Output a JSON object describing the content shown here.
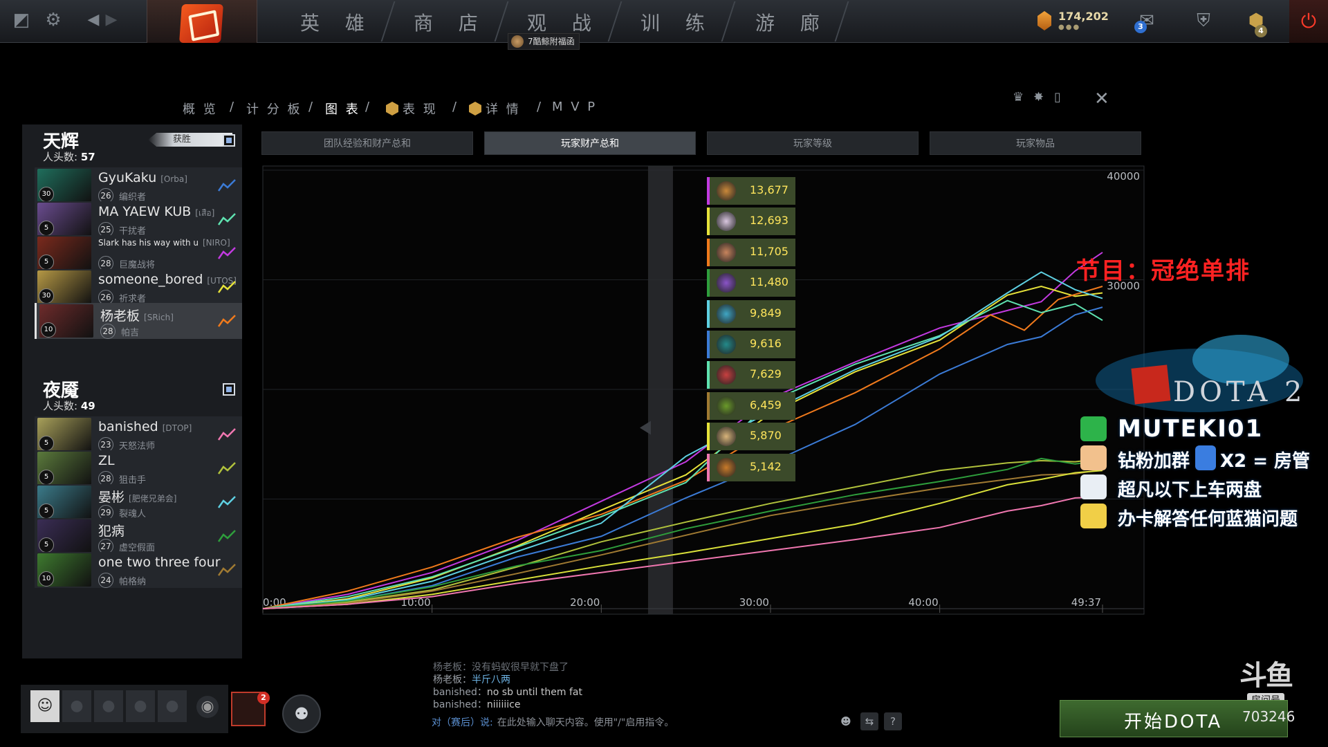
{
  "nav": {
    "items": [
      "英 雄",
      "商 店",
      "观 战",
      "训 练",
      "游 廊"
    ],
    "watch_badge": "7酷鲸附福函",
    "currency": "174,202",
    "currency_dots": "●●●",
    "notif_mail": "3",
    "notif_plus": "4"
  },
  "tabs": {
    "overview": "概 览",
    "scoreboard": "计 分 板",
    "graphs": "图 表",
    "performance": "表 现",
    "details": "详 情",
    "mvp": "M V P",
    "sep": "/"
  },
  "radiant": {
    "name": "天辉",
    "kills_label": "人头数:",
    "kills": "57",
    "win_label": "获胜",
    "players": [
      {
        "name": "GyuKaku",
        "tag": "[Orba]",
        "level": "26",
        "hero": "编织者",
        "badge": "30",
        "color": "#3b7bd6"
      },
      {
        "name": "MA YAEW KUB",
        "tag": "[เสือ]",
        "level": "25",
        "hero": "干扰者",
        "badge": "5",
        "color": "#5fe2b0"
      },
      {
        "name": "Slark has his way with u",
        "tag": "[NIRO]",
        "level": "28",
        "hero": "巨魔战将",
        "badge": "5",
        "color": "#c23ae0"
      },
      {
        "name": "someone_bored",
        "tag": "[UTOS]",
        "level": "26",
        "hero": "祈求者",
        "badge": "30",
        "color": "#e6e23a"
      },
      {
        "name": "杨老板",
        "tag": "[SRich]",
        "level": "28",
        "hero": "帕吉",
        "badge": "10",
        "color": "#f07a1c"
      }
    ]
  },
  "dire": {
    "name": "夜魇",
    "kills_label": "人头数:",
    "kills": "49",
    "players": [
      {
        "name": "banished",
        "tag": "[DTOP]",
        "level": "23",
        "hero": "天怒法师",
        "badge": "5",
        "color": "#f077b0"
      },
      {
        "name": "ZL",
        "tag": "",
        "level": "28",
        "hero": "狙击手",
        "badge": "5",
        "color": "#b1c23c"
      },
      {
        "name": "晏彬",
        "tag": "[肥佬兄弟会]",
        "level": "29",
        "hero": "裂魂人",
        "badge": "5",
        "color": "#5ed0e2"
      },
      {
        "name": "犯病",
        "tag": "",
        "level": "27",
        "hero": "虚空假面",
        "badge": "5",
        "color": "#2e9e3c"
      },
      {
        "name": "one two three four",
        "tag": "",
        "level": "24",
        "hero": "帕格纳",
        "badge": "10",
        "color": "#a07a32"
      }
    ]
  },
  "chart_tabs": [
    "团队经验和财产总和",
    "玩家财产总和",
    "玩家等级",
    "玩家物品"
  ],
  "chart_data": {
    "type": "line",
    "title": "玩家财产总和",
    "x_ticks": [
      "0:00",
      "10:00",
      "20:00",
      "30:00",
      "40:00",
      "49:37"
    ],
    "y_ticks": [
      "40000",
      "30000"
    ],
    "xlim": [
      0,
      49.62
    ],
    "ylim": [
      0,
      40000
    ],
    "grid": true,
    "series": [
      {
        "color": "#c23ae0",
        "points": [
          [
            0,
            0
          ],
          [
            5,
            1300
          ],
          [
            10,
            3300
          ],
          [
            15,
            6200
          ],
          [
            20,
            9800
          ],
          [
            25,
            13400
          ],
          [
            30,
            19200
          ],
          [
            35,
            22500
          ],
          [
            40,
            25600
          ],
          [
            44,
            27200
          ],
          [
            46,
            28000
          ],
          [
            48,
            30800
          ],
          [
            49.62,
            32500
          ]
        ]
      },
      {
        "color": "#e6e23a",
        "points": [
          [
            0,
            0
          ],
          [
            5,
            900
          ],
          [
            10,
            2800
          ],
          [
            15,
            5700
          ],
          [
            20,
            9000
          ],
          [
            25,
            12200
          ],
          [
            30,
            17800
          ],
          [
            35,
            21600
          ],
          [
            40,
            24500
          ],
          [
            44,
            28600
          ],
          [
            46,
            29400
          ],
          [
            48,
            28500
          ],
          [
            49.62,
            28800
          ]
        ]
      },
      {
        "color": "#f07a1c",
        "points": [
          [
            0,
            0
          ],
          [
            5,
            1600
          ],
          [
            10,
            3800
          ],
          [
            15,
            6500
          ],
          [
            20,
            8600
          ],
          [
            25,
            11700
          ],
          [
            30,
            16300
          ],
          [
            35,
            19700
          ],
          [
            40,
            23700
          ],
          [
            43,
            26800
          ],
          [
            45,
            25400
          ],
          [
            47,
            28200
          ],
          [
            49.62,
            29400
          ]
        ]
      },
      {
        "color": "#5fe2b0",
        "points": [
          [
            0,
            0
          ],
          [
            5,
            1100
          ],
          [
            10,
            2900
          ],
          [
            15,
            5600
          ],
          [
            20,
            8400
          ],
          [
            25,
            11500
          ],
          [
            30,
            18900
          ],
          [
            35,
            22300
          ],
          [
            40,
            24900
          ],
          [
            44,
            28100
          ],
          [
            46,
            27000
          ],
          [
            48,
            27800
          ],
          [
            49.62,
            26300
          ]
        ]
      },
      {
        "color": "#5ed0e2",
        "points": [
          [
            0,
            0
          ],
          [
            5,
            800
          ],
          [
            10,
            2500
          ],
          [
            15,
            5200
          ],
          [
            20,
            7800
          ],
          [
            25,
            13900
          ],
          [
            30,
            18000
          ],
          [
            35,
            21800
          ],
          [
            40,
            24800
          ],
          [
            44,
            28800
          ],
          [
            46,
            30700
          ],
          [
            48,
            29100
          ],
          [
            49.62,
            28300
          ]
        ]
      },
      {
        "color": "#3b7bd6",
        "points": [
          [
            0,
            0
          ],
          [
            5,
            700
          ],
          [
            10,
            2100
          ],
          [
            15,
            4700
          ],
          [
            20,
            6600
          ],
          [
            25,
            10100
          ],
          [
            30,
            13300
          ],
          [
            35,
            16800
          ],
          [
            40,
            21400
          ],
          [
            44,
            24100
          ],
          [
            46,
            24800
          ],
          [
            48,
            26800
          ],
          [
            49.62,
            27500
          ]
        ]
      },
      {
        "color": "#b1c23c",
        "points": [
          [
            0,
            0
          ],
          [
            5,
            600
          ],
          [
            10,
            1700
          ],
          [
            15,
            3800
          ],
          [
            20,
            6100
          ],
          [
            25,
            7900
          ],
          [
            30,
            9600
          ],
          [
            35,
            11100
          ],
          [
            40,
            12600
          ],
          [
            44,
            13300
          ],
          [
            46,
            13500
          ],
          [
            48,
            13400
          ],
          [
            49.62,
            13700
          ]
        ]
      },
      {
        "color": "#2e9e3c",
        "points": [
          [
            0,
            0
          ],
          [
            5,
            700
          ],
          [
            10,
            2000
          ],
          [
            15,
            3900
          ],
          [
            20,
            5300
          ],
          [
            25,
            7300
          ],
          [
            30,
            8900
          ],
          [
            35,
            10400
          ],
          [
            40,
            11600
          ],
          [
            44,
            12700
          ],
          [
            46,
            13700
          ],
          [
            48,
            13200
          ],
          [
            49.62,
            13500
          ]
        ]
      },
      {
        "color": "#a07a32",
        "points": [
          [
            0,
            0
          ],
          [
            5,
            500
          ],
          [
            10,
            1600
          ],
          [
            15,
            3200
          ],
          [
            20,
            4900
          ],
          [
            25,
            6700
          ],
          [
            30,
            8500
          ],
          [
            35,
            9800
          ],
          [
            40,
            11000
          ],
          [
            44,
            11800
          ],
          [
            46,
            12200
          ],
          [
            48,
            12300
          ],
          [
            49.62,
            12700
          ]
        ]
      },
      {
        "color": "#d9e03a",
        "points": [
          [
            0,
            0
          ],
          [
            5,
            400
          ],
          [
            10,
            1300
          ],
          [
            15,
            2600
          ],
          [
            20,
            3900
          ],
          [
            25,
            5100
          ],
          [
            30,
            6400
          ],
          [
            35,
            7700
          ],
          [
            40,
            9600
          ],
          [
            44,
            11300
          ],
          [
            46,
            11800
          ],
          [
            48,
            12400
          ],
          [
            49.62,
            12600
          ]
        ]
      },
      {
        "color": "#f077b0",
        "points": [
          [
            0,
            0
          ],
          [
            5,
            400
          ],
          [
            10,
            1100
          ],
          [
            15,
            2300
          ],
          [
            20,
            3300
          ],
          [
            25,
            4300
          ],
          [
            30,
            5300
          ],
          [
            35,
            6300
          ],
          [
            40,
            7400
          ],
          [
            44,
            8900
          ],
          [
            46,
            9400
          ],
          [
            48,
            10100
          ],
          [
            49.62,
            10200
          ]
        ]
      }
    ],
    "tooltip_values": [
      {
        "value": "13,677",
        "color": "#c23ae0"
      },
      {
        "value": "12,693",
        "color": "#e6e23a"
      },
      {
        "value": "11,705",
        "color": "#f07a1c"
      },
      {
        "value": "11,480",
        "color": "#2e9e3c"
      },
      {
        "value": "9,849",
        "color": "#5ed0e2"
      },
      {
        "value": "9,616",
        "color": "#3b7bd6"
      },
      {
        "value": "7,629",
        "color": "#5fe2b0"
      },
      {
        "value": "6,459",
        "color": "#a07a32"
      },
      {
        "value": "5,870",
        "color": "#e6e23a"
      },
      {
        "value": "5,142",
        "color": "#f077b0"
      }
    ]
  },
  "overlay": {
    "title": "节目：冠绝单排",
    "dota2": "DOTA 2",
    "lines": [
      "MUTEKI01",
      "钻粉加群",
      "X2 = 房管",
      "超凡以下上车两盘",
      "办卡解答任何蓝猫问题"
    ],
    "douyu": "斗鱼",
    "douyu_sub": "房间号"
  },
  "chat": {
    "lines": [
      {
        "who": "杨老板：",
        "msg": "没有蚂蚁很早就下盘了",
        "style": "dim"
      },
      {
        "who": "杨老板：",
        "msg": "半斤八两",
        "style": "cn"
      },
      {
        "who": "banished：",
        "msg": "no sb until them fat",
        "style": ""
      },
      {
        "who": "banished：",
        "msg": "niiiiiice",
        "style": ""
      }
    ],
    "input_label": "对（赛后）说:",
    "input_placeholder": "在此处输入聊天内容。使用\"/\"启用指令。"
  },
  "play_button": "开始DOTA",
  "room_number": "703246",
  "party_notif": "2"
}
